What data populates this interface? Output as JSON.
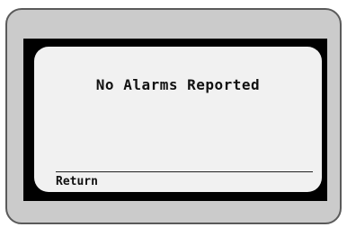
{
  "display": {
    "message": "No Alarms Reported",
    "softkey_label": "Return"
  }
}
